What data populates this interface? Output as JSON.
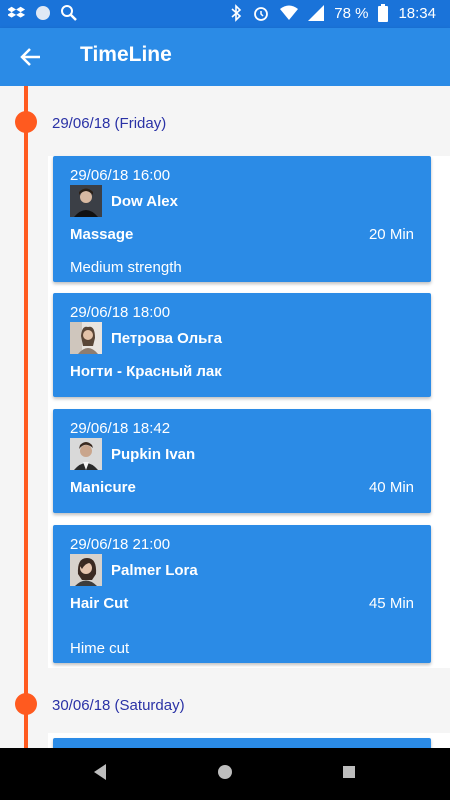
{
  "status_bar": {
    "battery": "78 %",
    "time": "18:34",
    "icons": [
      "dropbox-icon",
      "circle-app-icon",
      "search-icon",
      "bluetooth-icon",
      "alarm-icon",
      "wifi-icon",
      "signal-icon",
      "battery-icon"
    ]
  },
  "app_bar": {
    "title": "TimeLine",
    "back_icon": "arrow-back-icon"
  },
  "timeline": {
    "days": [
      {
        "date_label": "29/06/18 (Friday)"
      },
      {
        "date_label": "30/06/18 (Saturday)"
      }
    ],
    "events": [
      {
        "datetime": "29/06/18  16:00",
        "name": "Dow Alex",
        "service": "Massage",
        "duration": "20 Min",
        "note": "Medium strength"
      },
      {
        "datetime": "29/06/18  18:00",
        "name": "Петрова Ольга",
        "service": "Ногти - Красный лак",
        "duration": "",
        "note": ""
      },
      {
        "datetime": "29/06/18  18:42",
        "name": "Pupkin Ivan",
        "service": "Manicure",
        "duration": "40 Min",
        "note": ""
      },
      {
        "datetime": "29/06/18  21:00",
        "name": "Palmer Lora",
        "service": "Hair Cut",
        "duration": "45 Min",
        "note": "Hime cut"
      }
    ]
  },
  "colors": {
    "primary": "#2b8be6",
    "status_bar": "#1a73d9",
    "timeline": "#ff5a1f",
    "date_text": "#2a32a6"
  },
  "nav_bar": {
    "icons": [
      "back-triangle-icon",
      "home-circle-icon",
      "recents-square-icon"
    ]
  }
}
